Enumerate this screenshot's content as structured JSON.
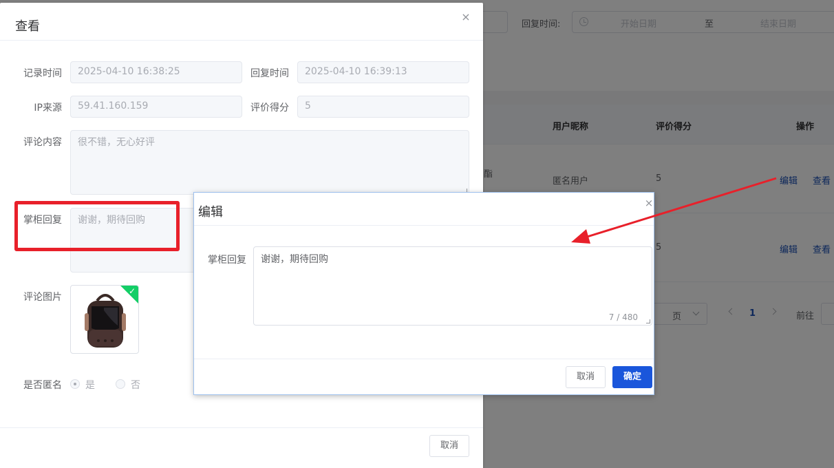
{
  "background": {
    "filters": {
      "reply_time_label": "回复时间:",
      "date_start_placeholder": "开始日期",
      "date_separator": "至",
      "date_end_placeholder": "结束日期"
    },
    "table": {
      "headers": {
        "nickname": "用户昵称",
        "score": "评价得分",
        "actions": "操作"
      },
      "rows": [
        {
          "partial_text": "酯",
          "nickname": "匿名用户",
          "score": "5",
          "edit": "编辑",
          "view": "查看"
        },
        {
          "nickname": "",
          "score": "5",
          "edit": "编辑",
          "view": "查看"
        }
      ]
    },
    "pagination": {
      "page_size_partial": "页",
      "current_page": "1",
      "goto_label": "前往"
    }
  },
  "view_dialog": {
    "title": "查看",
    "close_icon": "×",
    "fields": {
      "record_time_label": "记录时间",
      "record_time_value": "2025-04-10 16:38:25",
      "reply_time_label": "回复时间",
      "reply_time_value": "2025-04-10 16:39:13",
      "ip_label": "IP来源",
      "ip_value": "59.41.160.159",
      "score_label": "评价得分",
      "score_value": "5",
      "comment_label": "评论内容",
      "comment_value": "很不错，无心好评",
      "shop_reply_label": "掌柜回复",
      "shop_reply_value": "谢谢，期待回购",
      "images_label": "评论图片",
      "anonymous_label": "是否匿名",
      "anonymous_yes": "是",
      "anonymous_no": "否",
      "anonymous_selected": "yes"
    },
    "cancel_button": "取消"
  },
  "edit_dialog": {
    "title": "编辑",
    "close_icon": "×",
    "reply_label": "掌柜回复",
    "reply_value": "谢谢，期待回购",
    "char_counter": "7 / 480",
    "cancel_button": "取消",
    "confirm_button": "确定"
  },
  "colors": {
    "primary": "#1a56db",
    "link": "#1a4fb5",
    "highlight_red": "#e8202a",
    "success_badge": "#13ce66"
  }
}
